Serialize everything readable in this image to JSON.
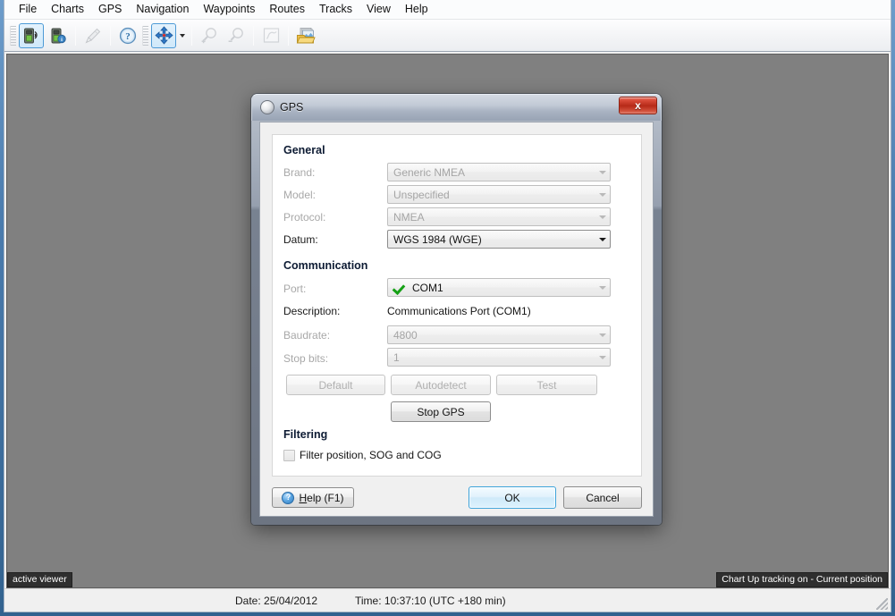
{
  "window": {
    "menu": [
      {
        "label": "File"
      },
      {
        "label": "Charts"
      },
      {
        "label": "GPS"
      },
      {
        "label": "Navigation"
      },
      {
        "label": "Waypoints"
      },
      {
        "label": "Routes"
      },
      {
        "label": "Tracks"
      },
      {
        "label": "View"
      },
      {
        "label": "Help"
      }
    ],
    "toolbar": [
      {
        "icon": "gps-connect-icon",
        "state": "selected"
      },
      {
        "icon": "gps-info-icon",
        "state": "normal"
      },
      {
        "icon": "measure-tool-icon",
        "state": "disabled"
      },
      {
        "icon": "help-circle-icon",
        "state": "normal"
      },
      {
        "icon": "pan-tool-icon",
        "state": "selected"
      },
      {
        "icon": "zoom-in-icon",
        "state": "disabled"
      },
      {
        "icon": "zoom-out-icon",
        "state": "disabled"
      },
      {
        "icon": "route-chart-icon",
        "state": "disabled"
      },
      {
        "icon": "chart-folder-icon",
        "state": "normal"
      }
    ],
    "canvas": {
      "left_chip": "active viewer",
      "right_chip": "Chart Up tracking on - Current position"
    },
    "status_bar": {
      "date": "Date: 25/04/2012",
      "time": "Time: 10:37:10 (UTC +180 min)"
    }
  },
  "dialog": {
    "title": "GPS",
    "close_label": "x",
    "general": {
      "heading": "General",
      "rows": [
        {
          "label": "Brand:",
          "value": "Generic NMEA",
          "enabled": false
        },
        {
          "label": "Model:",
          "value": "Unspecified",
          "enabled": false
        },
        {
          "label": "Protocol:",
          "value": "NMEA",
          "enabled": false
        },
        {
          "label": "Datum:",
          "value": "WGS 1984 (WGE)",
          "enabled": true
        }
      ]
    },
    "communication": {
      "heading": "Communication",
      "port_label": "Port:",
      "port_value": "COM1",
      "port_status_icon": "green-check-icon",
      "description_label": "Description:",
      "description_value": "Communications Port (COM1)",
      "baudrate_label": "Baudrate:",
      "baudrate_value": "4800",
      "stopbits_label": "Stop bits:",
      "stopbits_value": "1",
      "buttons": [
        {
          "label": "Default",
          "enabled": false
        },
        {
          "label": "Autodetect",
          "enabled": false
        },
        {
          "label": "Test",
          "enabled": false
        }
      ],
      "stop_gps_label": "Stop GPS"
    },
    "filtering": {
      "heading": "Filtering",
      "checkbox_label": "Filter position, SOG and COG",
      "checked": false
    },
    "footer": {
      "help_prefix": "",
      "help_accel": "H",
      "help_suffix": "elp (F1)",
      "ok_label": "OK",
      "cancel_label": "Cancel"
    }
  },
  "colors": {
    "accent_blue": "#3fa4da",
    "frame_blue": "#4b7cae",
    "canvas_gray": "#808080",
    "close_red": "#b62a18",
    "ok_check_green": "#15a015"
  }
}
